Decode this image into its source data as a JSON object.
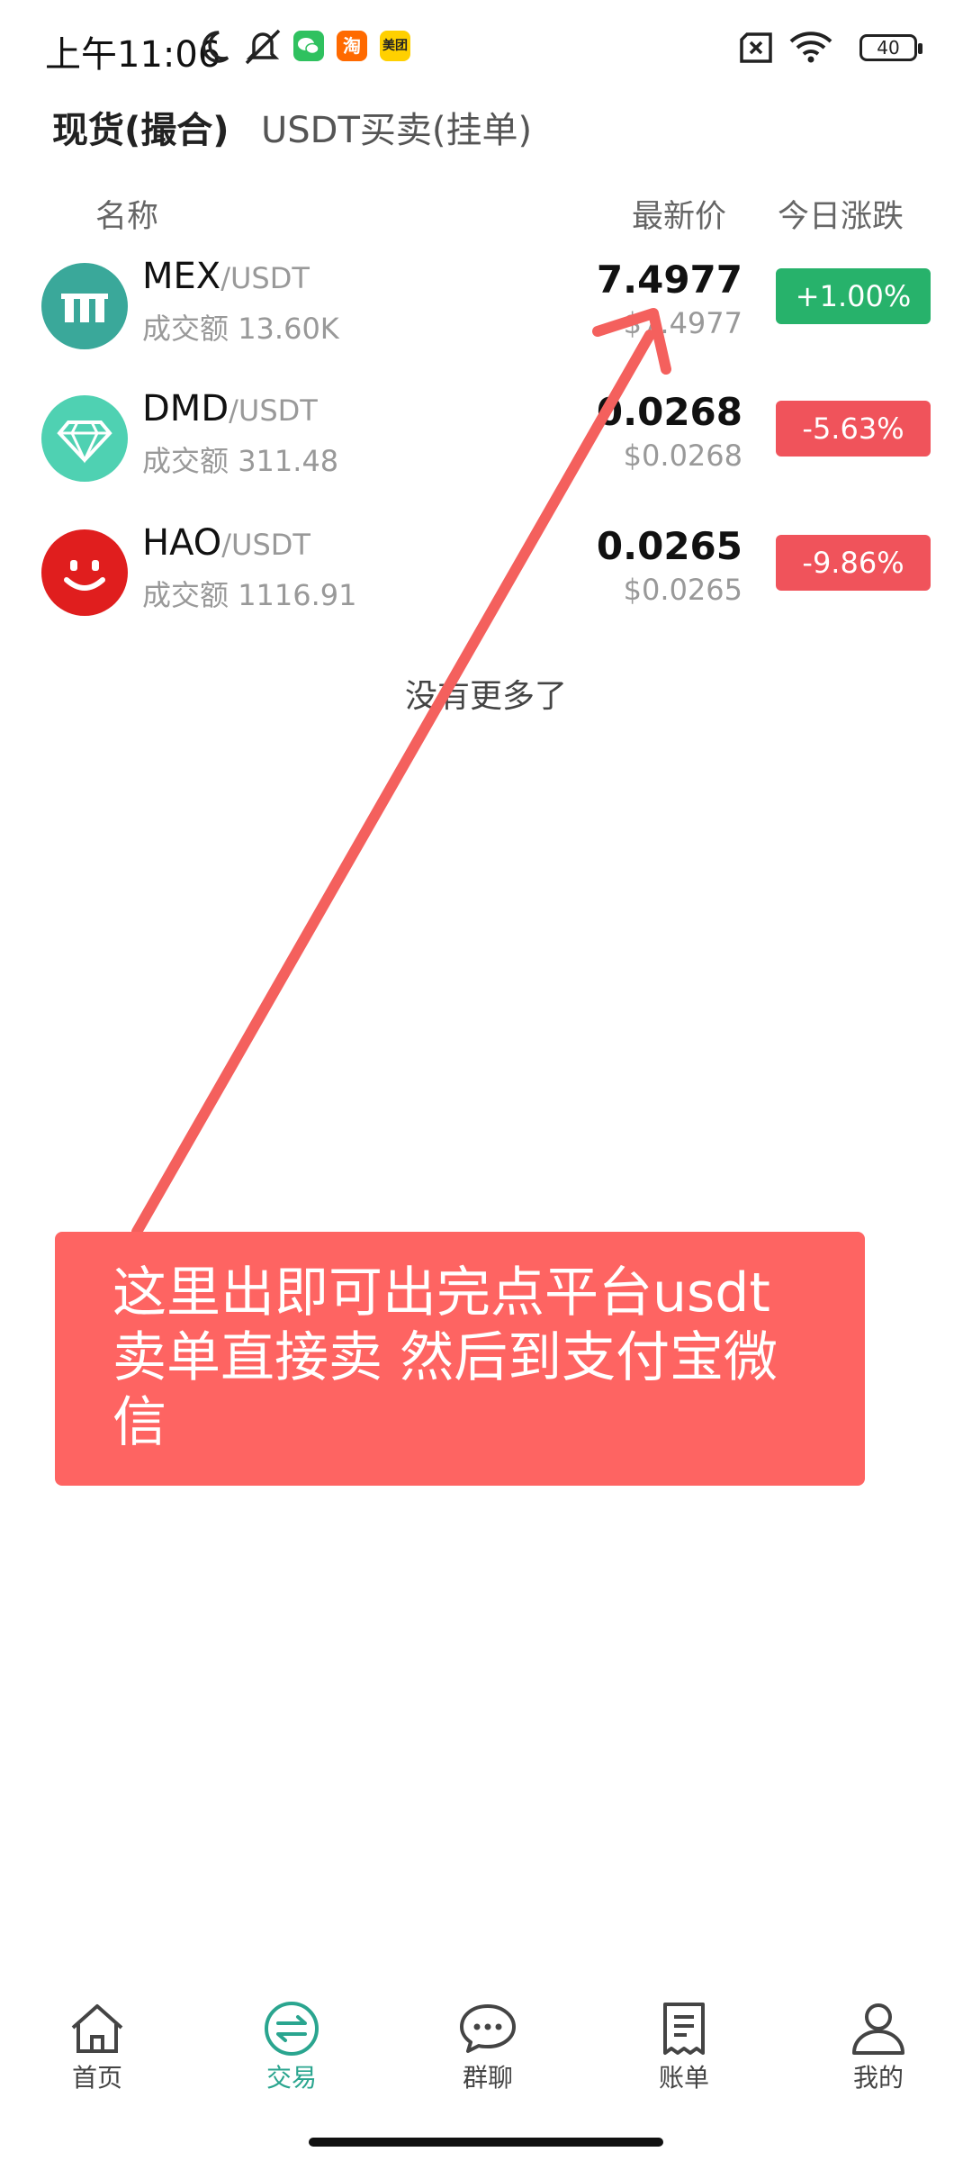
{
  "status_bar": {
    "time": "上午11:06",
    "icons": [
      "moon-icon",
      "mute-icon",
      "wechat-icon",
      "taobao-icon",
      "meituan-icon",
      "no-sim-icon",
      "wifi-icon"
    ],
    "taobao_label": "淘",
    "meituan_label": "美团",
    "battery": "40"
  },
  "tabs": [
    {
      "label": "现货(撮合)",
      "active": true
    },
    {
      "label": "USDT买卖(挂单)",
      "active": false
    }
  ],
  "table_header": {
    "name": "名称",
    "price": "最新价",
    "change": "今日涨跌"
  },
  "rows": [
    {
      "base": "MEX",
      "quote": "/USDT",
      "volume_label": "成交额",
      "volume": "13.60K",
      "price": "7.4977",
      "price_sub": "$7.4977",
      "change": "+1.00%",
      "color": "#27b26b",
      "icon": "mex-logo-icon"
    },
    {
      "base": "DMD",
      "quote": "/USDT",
      "volume_label": "成交额",
      "volume": "311.48",
      "price": "0.0268",
      "price_sub": "$0.0268",
      "change": "-5.63%",
      "color": "#f0535b",
      "icon": "diamond-logo-icon"
    },
    {
      "base": "HAO",
      "quote": "/USDT",
      "volume_label": "成交额",
      "volume": "1116.91",
      "price": "0.0265",
      "price_sub": "$0.0265",
      "change": "-9.86%",
      "color": "#f0535b",
      "icon": "smiley-logo-icon"
    }
  ],
  "no_more": "没有更多了",
  "annotation": {
    "text": "这里出即可出完点平台usdt卖单直接卖 然后到支付宝微信",
    "color": "#fe6462"
  },
  "bottom_nav": [
    {
      "label": "首页",
      "icon": "home-icon",
      "active": false
    },
    {
      "label": "交易",
      "icon": "exchange-icon",
      "active": true
    },
    {
      "label": "群聊",
      "icon": "chat-icon",
      "active": false
    },
    {
      "label": "账单",
      "icon": "bill-icon",
      "active": false
    },
    {
      "label": "我的",
      "icon": "profile-icon",
      "active": false
    }
  ],
  "accent_color": "#2aa58f"
}
